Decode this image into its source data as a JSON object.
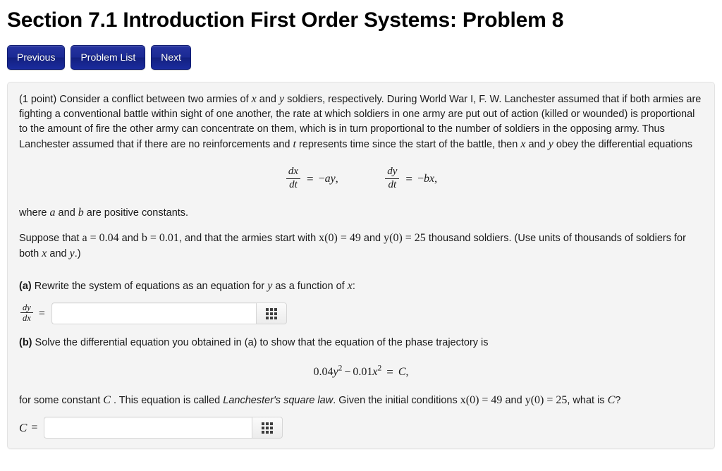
{
  "page_title": "Section 7.1 Introduction First Order Systems: Problem 8",
  "nav": {
    "previous": "Previous",
    "problem_list": "Problem List",
    "next": "Next"
  },
  "problem": {
    "points": "(1 point)",
    "intro_part1": " Consider a conflict between two armies of ",
    "var_x": "x",
    "intro_and": " and ",
    "var_y": "y",
    "intro_part2": " soldiers, respectively. During World War I, F. W. Lanchester assumed that if both armies are fighting a conventional battle within sight of one another, the rate at which soldiers in one army are put out of action (killed or wounded) is proportional to the amount of fire the other army can concentrate on them, which is in turn proportional to the number of soldiers in the opposing army. Thus Lanchester assumed that if there are no reinforcements and ",
    "var_t": "t",
    "intro_part3": " represents time since the start of the battle, then ",
    "intro_part4": " and ",
    "intro_part5": " obey the differential equations",
    "eq1": {
      "num": "dx",
      "den": "dt",
      "equals": "=",
      "rhs_sign": "−",
      "rhs": "ay",
      "comma": ","
    },
    "eq2": {
      "num": "dy",
      "den": "dt",
      "equals": "=",
      "rhs_sign": "−",
      "rhs": "bx",
      "comma": ","
    },
    "where_part1": "where ",
    "var_a": "a",
    "where_and": " and ",
    "var_b": "b",
    "where_part2": " are positive constants.",
    "suppose_part1": "Suppose that ",
    "suppose_a_eq": "a = 0.04",
    "suppose_and": " and ",
    "suppose_b_eq": "b = 0.01",
    "suppose_part2": ", and that the armies start with ",
    "suppose_x0": "x(0) = 49",
    "suppose_and2": " and ",
    "suppose_y0": "y(0) = 25",
    "suppose_part3": " thousand soldiers. (Use units of thousands of soldiers for both ",
    "suppose_part4": " and ",
    "suppose_part5": ".)",
    "part_a_label": "(a)",
    "part_a_text": " Rewrite the system of equations as an equation for ",
    "part_a_text2": " as a function of ",
    "part_a_text3": ":",
    "part_a_prefix_num": "dy",
    "part_a_prefix_den": "dx",
    "part_a_prefix_equals": "=",
    "part_a_answer_value": "",
    "part_a_answer_placeholder": "",
    "part_b_label": "(b)",
    "part_b_text": " Solve the differential equation you obtained in (a) to show that the equation of the phase trajectory is",
    "eq3": {
      "term1_coef": "0.04",
      "term1_var": "y",
      "term1_pow": "2",
      "minus": "−",
      "term2_coef": "0.01",
      "term2_var": "x",
      "term2_pow": "2",
      "equals": "=",
      "rhs": "C",
      "comma": ","
    },
    "closing_part1": "for some constant ",
    "const_C": "C",
    "closing_part2": " . This equation is called ",
    "law_name": "Lanchester's square law",
    "closing_part3": ". Given the initial conditions ",
    "closing_x0": "x(0) = 49",
    "closing_and": " and ",
    "closing_y0": "y(0) = 25",
    "closing_part4": ", what is ",
    "closing_part5": "?",
    "part_c_prefix_C": "C",
    "part_c_prefix_equals": "=",
    "part_c_answer_value": "",
    "part_c_answer_placeholder": ""
  },
  "icons": {
    "keypad": "math-keypad-grid-icon"
  },
  "colors": {
    "button_blue": "#1a2a9c",
    "panel_bg": "#f4f4f4",
    "panel_border": "#e3e3e3"
  }
}
